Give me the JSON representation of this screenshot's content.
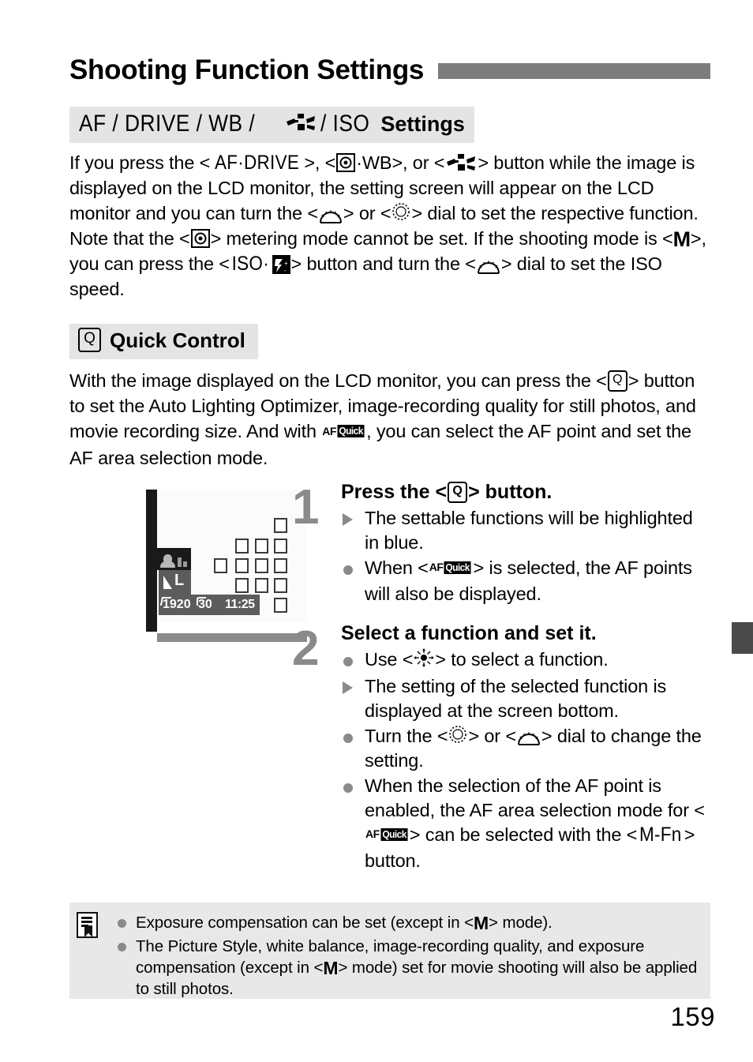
{
  "page": {
    "title": "Shooting Function Settings",
    "number": "159"
  },
  "subhead": {
    "prefix": "AF / DRIVE / WB /",
    "icon": "picture-style-icon",
    "suffix": "/ ISO",
    "settings_word": "Settings"
  },
  "intro": {
    "t1": "If you press the <",
    "btn_afdrive": "AF·DRIVE",
    "t2": ">, <",
    "icon_metering": "metering-mode-icon",
    "t3": "·WB>, or <",
    "icon_pstyle": "picture-style-icon",
    "t4": "> button while the image is displayed on the LCD monitor, the setting screen will appear on the LCD monitor and you can turn the <",
    "icon_maindial": "main-dial-icon",
    "t5": "> or <",
    "icon_qcdial": "quick-control-dial-icon",
    "t6": "> dial to set the respective function. Note that the <",
    "icon_metering2": "metering-mode-icon",
    "t7": "> metering mode cannot be set. If the shooting mode is <",
    "mode_M": "M",
    "t8": ">, you can press the <",
    "btn_iso": "ISO·",
    "icon_flashcomp": "flash-exposure-comp-icon",
    "t9": "> button and turn the <",
    "icon_maindial2": "main-dial-icon",
    "t10": "> dial to set the ISO speed."
  },
  "quick_control": {
    "heading": "Quick Control",
    "heading_icon": "q-button-icon",
    "q_label": "Q",
    "p1": "With the image displayed on the LCD monitor, you can press the <",
    "p2": "> button to set the Auto Lighting Optimizer, image-recording quality for still photos, and movie recording size. And with ",
    "afquick_af": "AF",
    "afquick_chip": "Quick",
    "p3": ", you can select the AF point and set the AF area selection mode."
  },
  "lcd": {
    "quality_label": "L",
    "resolution": "1920",
    "framerate": "30",
    "timecode": "11:25"
  },
  "steps": [
    {
      "number": "1",
      "title_a": "Press the <",
      "title_q": "Q",
      "title_b": "> button.",
      "bullets": [
        {
          "mark": "triangle",
          "text_a": "The settable functions will be highlighted in blue.",
          "text_b": ""
        },
        {
          "mark": "dot",
          "text_a": "When <",
          "glyph": "af-quick-icon",
          "text_b": "> is selected, the AF points will also be displayed."
        }
      ]
    },
    {
      "number": "2",
      "title_a": "Select a function and set it.",
      "bullets": [
        {
          "mark": "dot",
          "text_a": "Use <",
          "glyph": "multi-controller-icon",
          "text_b": "> to select a function."
        },
        {
          "mark": "triangle",
          "text_a": "The setting of the selected function is displayed at the screen bottom.",
          "text_b": ""
        },
        {
          "mark": "dot",
          "text_a": "Turn the <",
          "glyph": "quick-control-dial-icon",
          "text_mid": "> or <",
          "glyph2": "main-dial-icon",
          "text_b": "> dial to change the setting."
        },
        {
          "mark": "dot",
          "text_a": "When the selection of the AF point is enabled, the AF area selection mode for <",
          "glyph": "af-quick-icon",
          "text_mid": "> can be selected with the <",
          "btn_mfn": "M-Fn",
          "text_b": "> button."
        }
      ]
    }
  ],
  "note": {
    "icon": "note-memo-icon",
    "items": [
      {
        "a": "Exposure compensation can be set (except in <",
        "m": "M",
        "b": "> mode)."
      },
      {
        "a": "The Picture Style, white balance, image-recording quality, and exposure compensation (except in <",
        "m": "M",
        "b": "> mode) set for movie shooting will also be applied to still photos."
      }
    ]
  },
  "colors": {
    "title_rule": "#7d7d7d",
    "subhead_bg": "#e4e4e4",
    "note_bg": "#e8e8e8",
    "step_num": "#8a8a8a",
    "bullet": "#8a8a8a",
    "side_tab": "#4a4a4a"
  }
}
